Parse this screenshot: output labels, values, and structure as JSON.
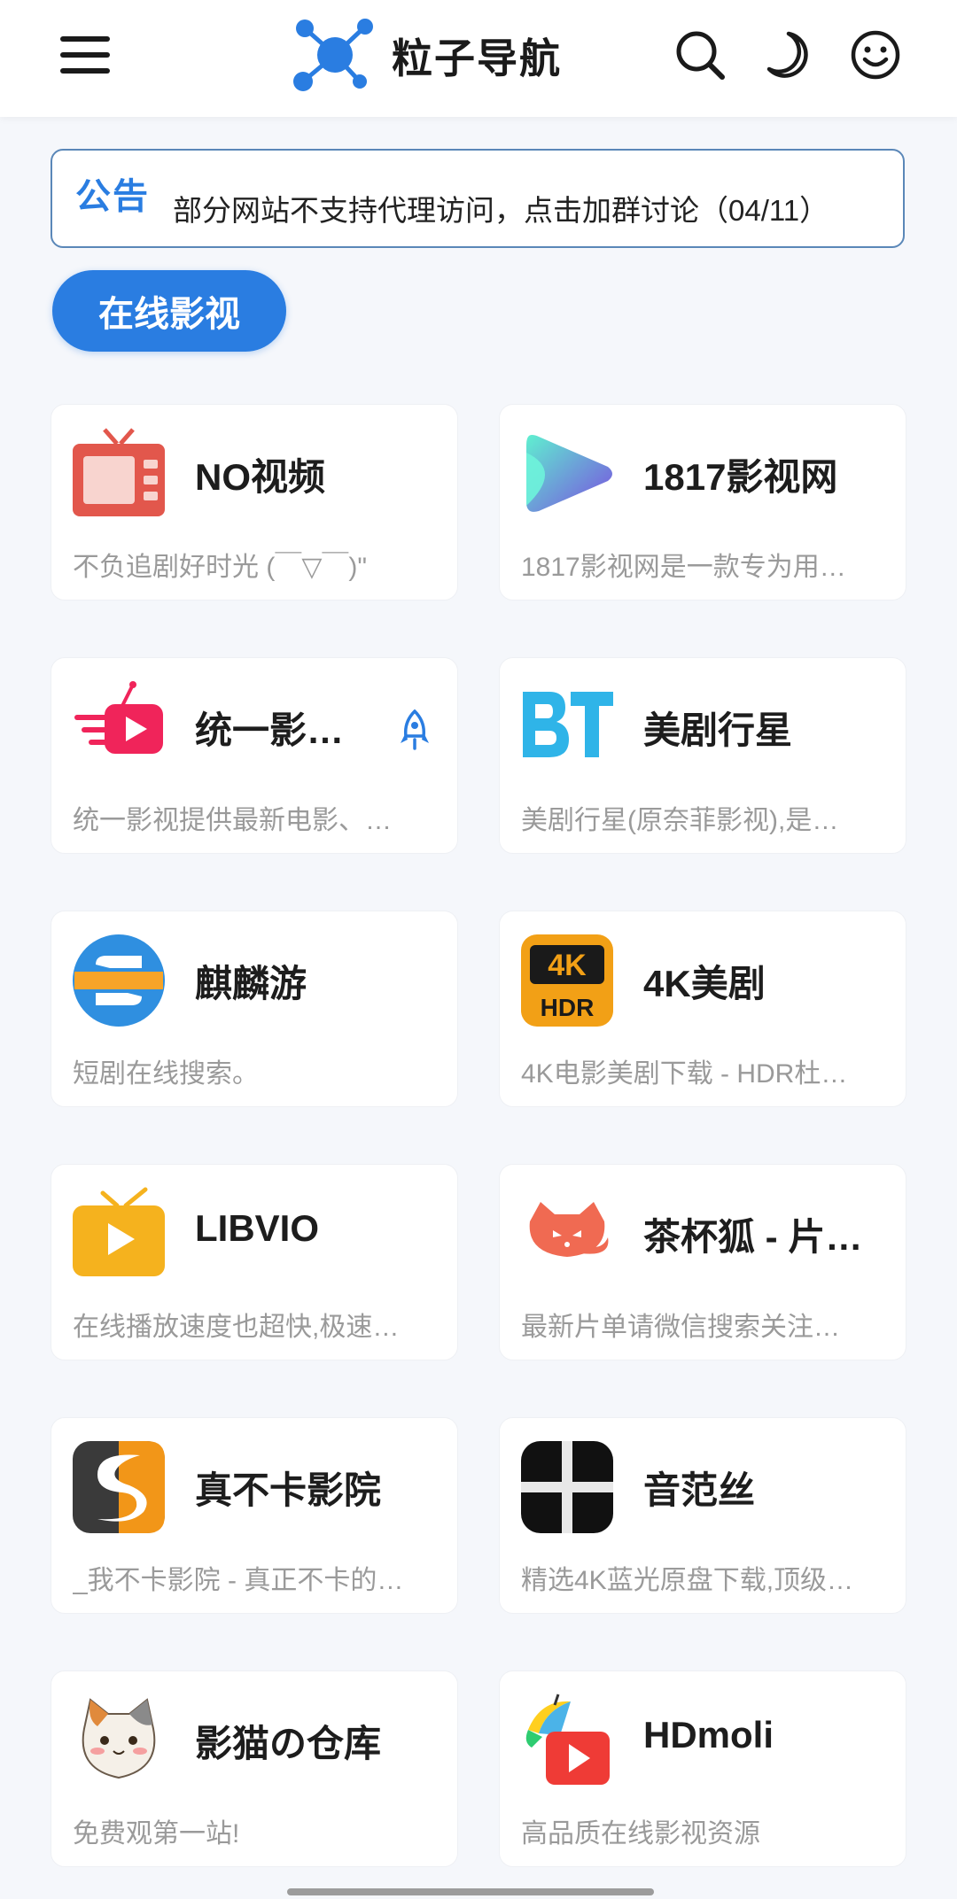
{
  "header": {
    "title": "粒子导航",
    "menu_icon": "menu-icon",
    "logo_icon": "molecule-logo-icon",
    "search_icon": "search-icon",
    "theme_icon": "moon-icon",
    "user_icon": "smiley-icon",
    "accent": "#2a7de1"
  },
  "notice": {
    "tag": "公告",
    "text": "部分网站不支持代理访问，点击加群讨论（04/11）"
  },
  "category": {
    "label": "在线影视"
  },
  "sites": [
    {
      "title": "NO视频",
      "desc": "不负追剧好时光 (￣▽￣)\"",
      "icon": "tv-icon"
    },
    {
      "title": "1817影视网",
      "desc": "1817影视网是一款专为用…",
      "icon": "play-icon"
    },
    {
      "title": "统一影…",
      "desc": "统一影视提供最新电影、…",
      "icon": "fast-play-icon",
      "badge_icon": "rocket-icon"
    },
    {
      "title": "美剧行星",
      "desc": "美剧行星(原奈菲影视),是…",
      "icon": "bt-logo-icon"
    },
    {
      "title": "麒麟游",
      "desc": "短剧在线搜索。",
      "icon": "s-logo-icon"
    },
    {
      "title": "4K美剧",
      "desc": "4K电影美剧下载 - HDR杜…",
      "icon": "4k-hdr-icon"
    },
    {
      "title": "LIBVIO",
      "desc": "在线播放速度也超快,极速…",
      "icon": "tv-play-icon"
    },
    {
      "title": "茶杯狐 - 片…",
      "desc": "最新片单请微信搜索关注…",
      "icon": "fox-icon"
    },
    {
      "title": "真不卡影院",
      "desc": "_我不卡影院 - 真正不卡的…",
      "icon": "s-swoosh-icon"
    },
    {
      "title": "音范丝",
      "desc": "精选4K蓝光原盘下载,顶级…",
      "icon": "cross-logo-icon"
    },
    {
      "title": "影猫の仓库",
      "desc": "免费观第一站!",
      "icon": "cat-icon"
    },
    {
      "title": "HDmoli",
      "desc": "高品质在线影视资源",
      "icon": "propeller-hat-play-icon"
    }
  ]
}
